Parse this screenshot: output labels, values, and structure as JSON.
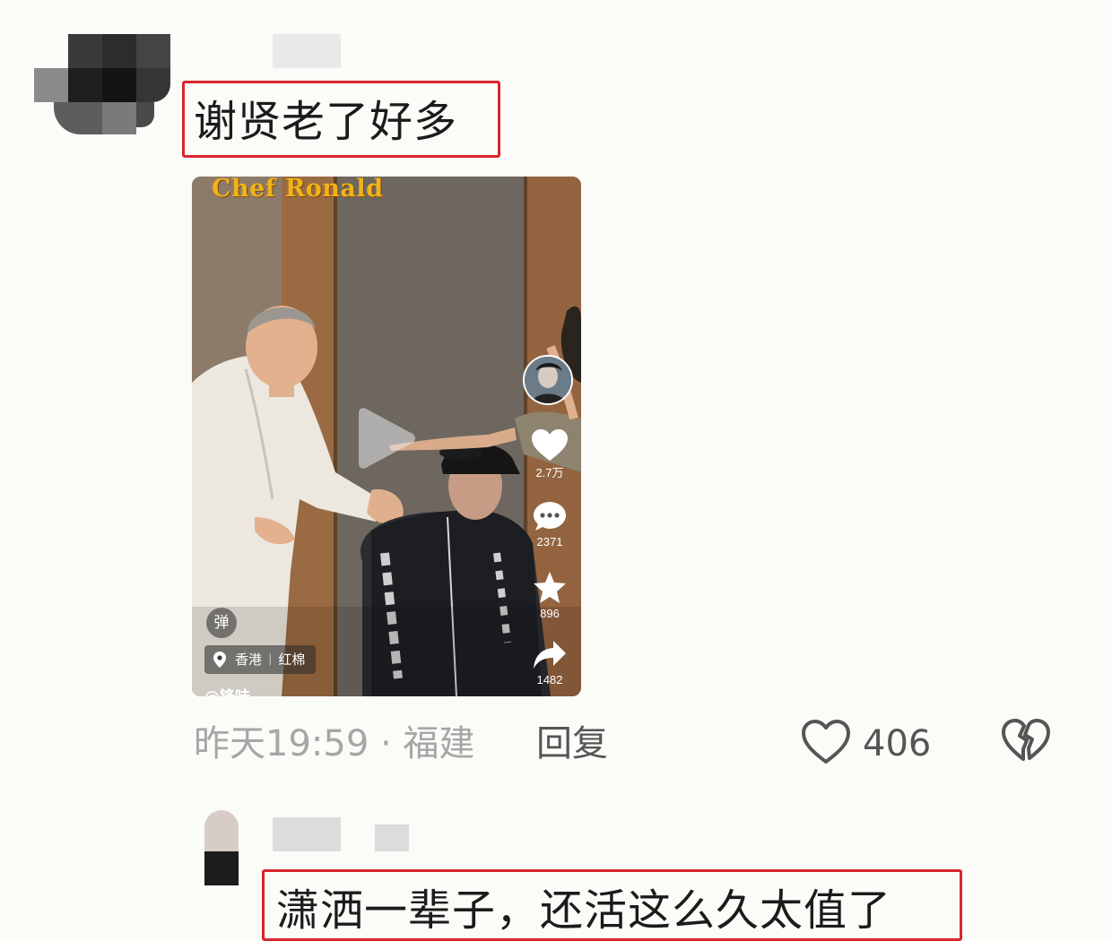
{
  "comment1": {
    "text": "谢贤老了好多",
    "time_location": "昨天19:59 · 福建",
    "reply_label": "回复",
    "like_count": "406",
    "icons": [
      "heart-outline-icon",
      "broken-heart-icon"
    ]
  },
  "video": {
    "title": "Chef Ronald",
    "danmu_label": "弹",
    "location": "香港",
    "location_sub": "红棉",
    "author_handle": "@锋味",
    "stats": {
      "likes": "2.7万",
      "comments": "2371",
      "favorites": "896",
      "shares": "1482"
    },
    "icons": [
      "play-icon",
      "heart-icon",
      "comment-icon",
      "star-icon",
      "share-icon",
      "location-pin-icon"
    ]
  },
  "comment2": {
    "text": "潇洒一辈子，还活这么久太值了"
  },
  "colors": {
    "highlight_box": "#d9262c",
    "background": "#fbfbf8",
    "meta_text": "#a6a6a6",
    "title_yellow": "#f2b21a"
  }
}
